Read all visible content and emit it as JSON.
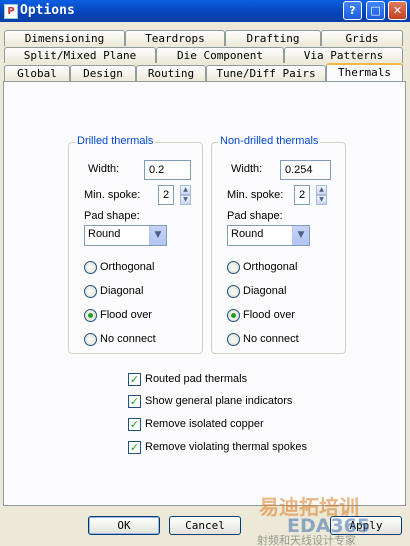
{
  "window": {
    "title": "Options",
    "icon": "pcb-app-icon"
  },
  "title_buttons": {
    "help": "?",
    "maximize": "□",
    "close": "✕"
  },
  "tabs": {
    "row1": [
      "Dimensioning",
      "Teardrops",
      "Drafting",
      "Grids"
    ],
    "row2": [
      "Split/Mixed Plane",
      "Die Component",
      "Via Patterns"
    ],
    "row3": [
      "Global",
      "Design",
      "Routing",
      "Tune/Diff Pairs",
      "Thermals"
    ],
    "active": "Thermals"
  },
  "drilled": {
    "title": "Drilled thermals",
    "width_label": "Width:",
    "width_value": "0.2",
    "spoke_label": "Min. spoke:",
    "spoke_value": "2",
    "pad_shape_label": "Pad shape:",
    "pad_shape_value": "Round",
    "options": [
      "Orthogonal",
      "Diagonal",
      "Flood over",
      "No connect"
    ],
    "selected": "Flood over"
  },
  "nondrilled": {
    "title": "Non-drilled thermals",
    "width_label": "Width:",
    "width_value": "0.254",
    "spoke_label": "Min. spoke:",
    "spoke_value": "2",
    "pad_shape_label": "Pad shape:",
    "pad_shape_value": "Round",
    "options": [
      "Orthogonal",
      "Diagonal",
      "Flood over",
      "No connect"
    ],
    "selected": "Flood over"
  },
  "checkboxes": [
    {
      "label": "Routed pad thermals",
      "checked": true
    },
    {
      "label": "Show general plane indicators",
      "checked": true
    },
    {
      "label": "Remove isolated copper",
      "checked": true
    },
    {
      "label": "Remove violating thermal spokes",
      "checked": true
    }
  ],
  "buttons": {
    "ok": "OK",
    "cancel": "Cancel",
    "apply": "Apply"
  },
  "watermark": {
    "line1": "易迪拓培训",
    "brand": "EDA365",
    "line2": "射频和天线设计专家"
  },
  "colors": {
    "titlebar": "#0a5fe0",
    "group_title": "#0046d5",
    "active_tab_accent": "#f7b94a",
    "check": "#21a121"
  }
}
